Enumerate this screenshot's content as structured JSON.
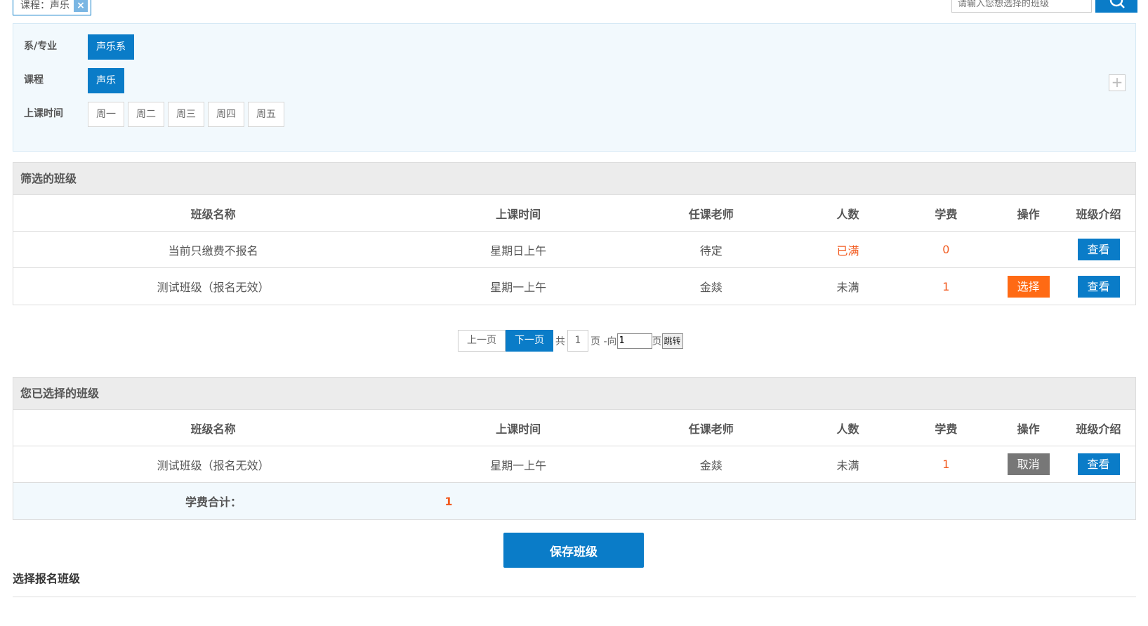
{
  "top": {
    "chip_label": "课程：声乐",
    "chip_close": "×",
    "search_placeholder": "请输入您想选择的班级"
  },
  "filters": {
    "dept_label": "系/专业",
    "dept_options": [
      "声乐系"
    ],
    "course_label": "课程",
    "course_options": [
      "声乐"
    ],
    "time_label": "上课时间",
    "time_options": [
      "周一",
      "周二",
      "周三",
      "周四",
      "周五"
    ],
    "expand": "+"
  },
  "columns": [
    "班级名称",
    "上课时间",
    "任课老师",
    "人数",
    "学费",
    "操作",
    "班级介绍"
  ],
  "filtered": {
    "title": "筛选的班级",
    "rows": [
      {
        "name": "当前只缴费不报名",
        "time": "星期日上午",
        "teacher": "待定",
        "count": "已满",
        "fee": "0",
        "action": "",
        "intro": "查看"
      },
      {
        "name": "测试班级（报名无效）",
        "time": "星期一上午",
        "teacher": "金燚",
        "count": "未满",
        "fee": "1",
        "action": "选择",
        "intro": "查看"
      }
    ]
  },
  "pager": {
    "prev": "上一页",
    "next": "下一页",
    "total_prefix": "共",
    "total_pages": "1",
    "total_suffix": "页 -向",
    "goto_value": "1",
    "goto_suffix": "页",
    "go": "跳转"
  },
  "selected": {
    "title": "您已选择的班级",
    "rows": [
      {
        "name": "测试班级（报名无效）",
        "time": "星期一上午",
        "teacher": "金燚",
        "count": "未满",
        "fee": "1",
        "action": "取消",
        "intro": "查看"
      }
    ],
    "total_label": "学费合计：",
    "total_value": "1"
  },
  "save_label": "保存班级",
  "bottom_title": "选择报名班级",
  "colors": {
    "accent": "#0a7cc8",
    "orange": "#ff6a14",
    "gray_btn": "#777777"
  }
}
